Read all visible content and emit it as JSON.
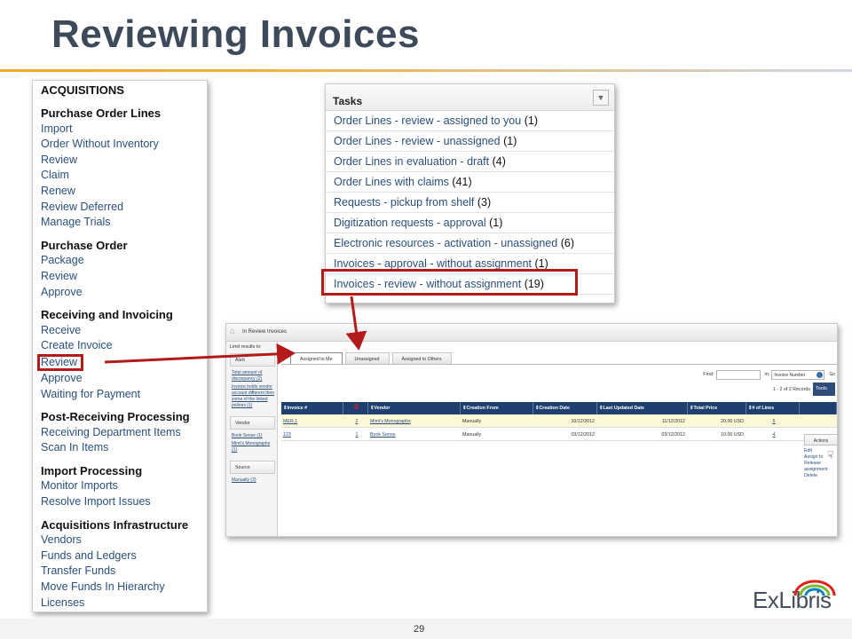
{
  "slide": {
    "title": "Reviewing Invoices",
    "page_number": "29",
    "logo_text": "ExLibris"
  },
  "menu": {
    "heading": "ACQUISITIONS",
    "sections": [
      {
        "title": "Purchase Order Lines",
        "items": [
          "Import",
          "Order Without Inventory",
          "Review",
          "Claim",
          "Renew",
          "Review Deferred",
          "Manage Trials"
        ]
      },
      {
        "title": "Purchase Order",
        "items": [
          "Package",
          "Review",
          "Approve"
        ]
      },
      {
        "title": "Receiving and Invoicing",
        "items": [
          "Receive",
          "Create Invoice",
          "Review",
          "Approve",
          "Waiting for Payment"
        ]
      },
      {
        "title": "Post-Receiving Processing",
        "items": [
          "Receiving Department Items",
          "Scan In Items"
        ]
      },
      {
        "title": "Import Processing",
        "items": [
          "Monitor Imports",
          "Resolve Import Issues"
        ]
      },
      {
        "title": "Acquisitions Infrastructure",
        "items": [
          "Vendors",
          "Funds and Ledgers",
          "Transfer Funds",
          "Move Funds In Hierarchy",
          "Licenses"
        ]
      }
    ]
  },
  "tasks": {
    "title": "Tasks",
    "rows": [
      {
        "label": "Order Lines - review - assigned to you",
        "count": "(1)"
      },
      {
        "label": "Order Lines - review - unassigned",
        "count": "(1)"
      },
      {
        "label": "Order Lines in evaluation - draft",
        "count": "(4)"
      },
      {
        "label": "Order Lines with claims",
        "count": "(41)"
      },
      {
        "label": "Requests - pickup from shelf",
        "count": "(3)"
      },
      {
        "label": "Digitization requests - approval",
        "count": "(1)"
      },
      {
        "label": "Electronic resources - activation - unassigned",
        "count": "(6)"
      },
      {
        "label": "Invoices - approval - without assignment",
        "count": "(1)"
      },
      {
        "label": "Invoices - review - without assignment",
        "count": "(19)"
      }
    ]
  },
  "invoices": {
    "page_title": "In Review Invoices",
    "limit_label": "Limit results to:",
    "facets": [
      {
        "title": "Alert",
        "links": [
          "Total amount of discrepancy (2)",
          "Invoice holds vendor account different then some of the linked polines (1)"
        ]
      },
      {
        "title": "Vendor",
        "links": [
          "Book Sense (1)",
          "Mimi's Monographs (1)"
        ]
      },
      {
        "title": "Source",
        "links": [
          "Manually (2)"
        ]
      }
    ],
    "tabs": [
      "Assigned to Me",
      "Unassigned",
      "Assigned to Others"
    ],
    "find_label": "Find:",
    "in_label": "in:",
    "in_value": "Invoice Number",
    "go_label": "Go",
    "records": "1 - 2 of 2 Records",
    "tools_label": "Tools",
    "columns": [
      "Invoice #",
      "0",
      "Vendor",
      "Creation From",
      "Creation Date",
      "Last Updated Date",
      "Total Price",
      "# of Lines"
    ],
    "rows": [
      {
        "invoice": "MER.1",
        "alerts": "2",
        "vendor": "Mimi's Monographs",
        "from": "Manually",
        "created": "10/12/2012",
        "updated": "11/12/2012",
        "price": "20.00 USD",
        "lines": "5"
      },
      {
        "invoice": "123",
        "alerts": "1",
        "vendor": "Book Sense",
        "from": "Manually",
        "created": "03/12/2012",
        "updated": "03/12/2012",
        "price": "10.00 USD",
        "lines": "4"
      }
    ],
    "actions_label": "Actions",
    "actions_menu": [
      "Edit",
      "Assign to",
      "Release",
      "assignment",
      "Delete"
    ]
  },
  "colors": {
    "highlight": "#b31b1b",
    "table_header": "#1f3f6e",
    "link": "#2a4f7c",
    "title": "#3d4a5a"
  }
}
